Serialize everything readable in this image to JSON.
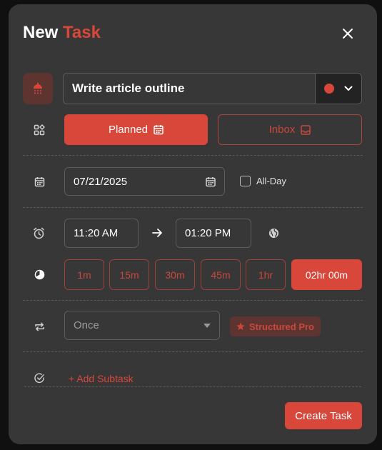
{
  "dialog": {
    "title_part1": "New",
    "title_part2": "Task"
  },
  "task": {
    "name": "Write article outline",
    "color": "#d9473b",
    "icon": "shower-icon"
  },
  "mode": {
    "planned_label": "Planned",
    "inbox_label": "Inbox",
    "selected": "Planned"
  },
  "date": {
    "value": "07/21/2025",
    "all_day_label": "All-Day",
    "all_day_checked": false
  },
  "time": {
    "start": "11:20 AM",
    "end": "01:20 PM"
  },
  "duration": {
    "options": [
      "1m",
      "15m",
      "30m",
      "45m",
      "1hr",
      "02hr 00m"
    ],
    "selected": "02hr 00m"
  },
  "repeat": {
    "value": "Once",
    "pro_badge_label": "Structured Pro"
  },
  "subtask": {
    "add_label": "+ Add Subtask"
  },
  "actions": {
    "create_label": "Create Task"
  },
  "colors": {
    "accent": "#d9473b",
    "background": "#373737",
    "backdrop": "#101010"
  }
}
